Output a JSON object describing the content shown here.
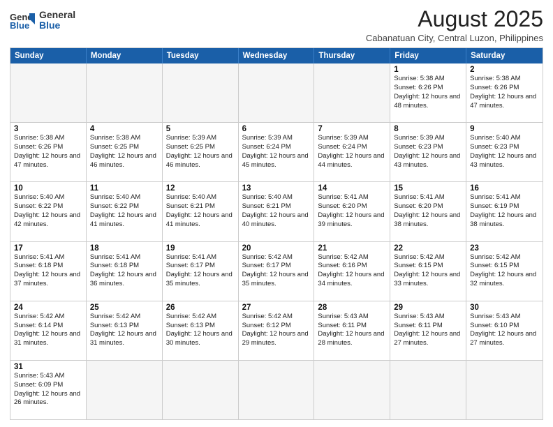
{
  "header": {
    "logo_general": "General",
    "logo_blue": "Blue",
    "month_year": "August 2025",
    "location": "Cabanatuan City, Central Luzon, Philippines"
  },
  "days_of_week": [
    "Sunday",
    "Monday",
    "Tuesday",
    "Wednesday",
    "Thursday",
    "Friday",
    "Saturday"
  ],
  "weeks": [
    [
      {
        "day": "",
        "empty": true
      },
      {
        "day": "",
        "empty": true
      },
      {
        "day": "",
        "empty": true
      },
      {
        "day": "",
        "empty": true
      },
      {
        "day": "",
        "empty": true
      },
      {
        "day": "1",
        "sunrise": "Sunrise: 5:38 AM",
        "sunset": "Sunset: 6:26 PM",
        "daylight": "Daylight: 12 hours and 48 minutes."
      },
      {
        "day": "2",
        "sunrise": "Sunrise: 5:38 AM",
        "sunset": "Sunset: 6:26 PM",
        "daylight": "Daylight: 12 hours and 47 minutes."
      }
    ],
    [
      {
        "day": "3",
        "sunrise": "Sunrise: 5:38 AM",
        "sunset": "Sunset: 6:26 PM",
        "daylight": "Daylight: 12 hours and 47 minutes."
      },
      {
        "day": "4",
        "sunrise": "Sunrise: 5:38 AM",
        "sunset": "Sunset: 6:25 PM",
        "daylight": "Daylight: 12 hours and 46 minutes."
      },
      {
        "day": "5",
        "sunrise": "Sunrise: 5:39 AM",
        "sunset": "Sunset: 6:25 PM",
        "daylight": "Daylight: 12 hours and 46 minutes."
      },
      {
        "day": "6",
        "sunrise": "Sunrise: 5:39 AM",
        "sunset": "Sunset: 6:24 PM",
        "daylight": "Daylight: 12 hours and 45 minutes."
      },
      {
        "day": "7",
        "sunrise": "Sunrise: 5:39 AM",
        "sunset": "Sunset: 6:24 PM",
        "daylight": "Daylight: 12 hours and 44 minutes."
      },
      {
        "day": "8",
        "sunrise": "Sunrise: 5:39 AM",
        "sunset": "Sunset: 6:23 PM",
        "daylight": "Daylight: 12 hours and 43 minutes."
      },
      {
        "day": "9",
        "sunrise": "Sunrise: 5:40 AM",
        "sunset": "Sunset: 6:23 PM",
        "daylight": "Daylight: 12 hours and 43 minutes."
      }
    ],
    [
      {
        "day": "10",
        "sunrise": "Sunrise: 5:40 AM",
        "sunset": "Sunset: 6:22 PM",
        "daylight": "Daylight: 12 hours and 42 minutes."
      },
      {
        "day": "11",
        "sunrise": "Sunrise: 5:40 AM",
        "sunset": "Sunset: 6:22 PM",
        "daylight": "Daylight: 12 hours and 41 minutes."
      },
      {
        "day": "12",
        "sunrise": "Sunrise: 5:40 AM",
        "sunset": "Sunset: 6:21 PM",
        "daylight": "Daylight: 12 hours and 41 minutes."
      },
      {
        "day": "13",
        "sunrise": "Sunrise: 5:40 AM",
        "sunset": "Sunset: 6:21 PM",
        "daylight": "Daylight: 12 hours and 40 minutes."
      },
      {
        "day": "14",
        "sunrise": "Sunrise: 5:41 AM",
        "sunset": "Sunset: 6:20 PM",
        "daylight": "Daylight: 12 hours and 39 minutes."
      },
      {
        "day": "15",
        "sunrise": "Sunrise: 5:41 AM",
        "sunset": "Sunset: 6:20 PM",
        "daylight": "Daylight: 12 hours and 38 minutes."
      },
      {
        "day": "16",
        "sunrise": "Sunrise: 5:41 AM",
        "sunset": "Sunset: 6:19 PM",
        "daylight": "Daylight: 12 hours and 38 minutes."
      }
    ],
    [
      {
        "day": "17",
        "sunrise": "Sunrise: 5:41 AM",
        "sunset": "Sunset: 6:18 PM",
        "daylight": "Daylight: 12 hours and 37 minutes."
      },
      {
        "day": "18",
        "sunrise": "Sunrise: 5:41 AM",
        "sunset": "Sunset: 6:18 PM",
        "daylight": "Daylight: 12 hours and 36 minutes."
      },
      {
        "day": "19",
        "sunrise": "Sunrise: 5:41 AM",
        "sunset": "Sunset: 6:17 PM",
        "daylight": "Daylight: 12 hours and 35 minutes."
      },
      {
        "day": "20",
        "sunrise": "Sunrise: 5:42 AM",
        "sunset": "Sunset: 6:17 PM",
        "daylight": "Daylight: 12 hours and 35 minutes."
      },
      {
        "day": "21",
        "sunrise": "Sunrise: 5:42 AM",
        "sunset": "Sunset: 6:16 PM",
        "daylight": "Daylight: 12 hours and 34 minutes."
      },
      {
        "day": "22",
        "sunrise": "Sunrise: 5:42 AM",
        "sunset": "Sunset: 6:15 PM",
        "daylight": "Daylight: 12 hours and 33 minutes."
      },
      {
        "day": "23",
        "sunrise": "Sunrise: 5:42 AM",
        "sunset": "Sunset: 6:15 PM",
        "daylight": "Daylight: 12 hours and 32 minutes."
      }
    ],
    [
      {
        "day": "24",
        "sunrise": "Sunrise: 5:42 AM",
        "sunset": "Sunset: 6:14 PM",
        "daylight": "Daylight: 12 hours and 31 minutes."
      },
      {
        "day": "25",
        "sunrise": "Sunrise: 5:42 AM",
        "sunset": "Sunset: 6:13 PM",
        "daylight": "Daylight: 12 hours and 31 minutes."
      },
      {
        "day": "26",
        "sunrise": "Sunrise: 5:42 AM",
        "sunset": "Sunset: 6:13 PM",
        "daylight": "Daylight: 12 hours and 30 minutes."
      },
      {
        "day": "27",
        "sunrise": "Sunrise: 5:42 AM",
        "sunset": "Sunset: 6:12 PM",
        "daylight": "Daylight: 12 hours and 29 minutes."
      },
      {
        "day": "28",
        "sunrise": "Sunrise: 5:43 AM",
        "sunset": "Sunset: 6:11 PM",
        "daylight": "Daylight: 12 hours and 28 minutes."
      },
      {
        "day": "29",
        "sunrise": "Sunrise: 5:43 AM",
        "sunset": "Sunset: 6:11 PM",
        "daylight": "Daylight: 12 hours and 27 minutes."
      },
      {
        "day": "30",
        "sunrise": "Sunrise: 5:43 AM",
        "sunset": "Sunset: 6:10 PM",
        "daylight": "Daylight: 12 hours and 27 minutes."
      }
    ],
    [
      {
        "day": "31",
        "sunrise": "Sunrise: 5:43 AM",
        "sunset": "Sunset: 6:09 PM",
        "daylight": "Daylight: 12 hours and 26 minutes."
      },
      {
        "day": "",
        "empty": true
      },
      {
        "day": "",
        "empty": true
      },
      {
        "day": "",
        "empty": true
      },
      {
        "day": "",
        "empty": true
      },
      {
        "day": "",
        "empty": true
      },
      {
        "day": "",
        "empty": true
      }
    ]
  ]
}
